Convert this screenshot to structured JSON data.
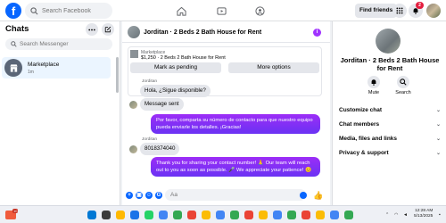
{
  "topbar": {
    "logo": "f",
    "search_placeholder": "Search Facebook",
    "find_friends_label": "Find friends",
    "notification_count": "2",
    "icons": [
      "home-icon",
      "video-icon",
      "groups-icon",
      "menu-grid-icon",
      "messenger-icon",
      "bell-icon"
    ]
  },
  "left": {
    "title": "Chats",
    "search_placeholder": "Search Messenger",
    "chats": [
      {
        "name": "Marketplace",
        "time": "1m",
        "icon": "shop-icon"
      }
    ]
  },
  "chat": {
    "header_title": "Jorditan · 2 Beds 2 Bath House for Rent",
    "card": {
      "label": "Marketplace",
      "price_line": "$1,250 · 2 Beds 2 Bath House for Rent",
      "button_pending": "Mark as pending",
      "button_more": "More options"
    },
    "messages": [
      {
        "sender": "Jorditan",
        "text": "Hola, ¿Sigue disponible?",
        "direction": "in"
      },
      {
        "text": "Message sent",
        "direction": "in"
      },
      {
        "text": "Por favor, comparta su número de contacto para que nuestro equipo pueda enviarle los detalles. ¡Gracias!",
        "direction": "out"
      },
      {
        "sender": "Jorditan",
        "text": "8018374040",
        "direction": "in"
      },
      {
        "text": "Thank you for sharing your contact number! 🙏 Our team will reach out to you as soon as possible. 🎤 We appreciate your patience! 😊",
        "direction": "out"
      }
    ],
    "composer_placeholder": "Aa"
  },
  "right": {
    "title": "Jorditan · 2 Beds 2 Bath House for Rent",
    "actions": [
      {
        "label": "Mute",
        "icon": "bell-icon"
      },
      {
        "label": "Search",
        "icon": "search-icon"
      }
    ],
    "rows": [
      "Customize chat",
      "Chat members",
      "Media, files and links",
      "Privacy & support"
    ]
  },
  "taskbar": {
    "badge": "10",
    "time": "12:28 AM",
    "date": "5/13/2025",
    "colors": {
      "accent": "#0866ff",
      "bubble_out": "#7f2df5"
    }
  }
}
